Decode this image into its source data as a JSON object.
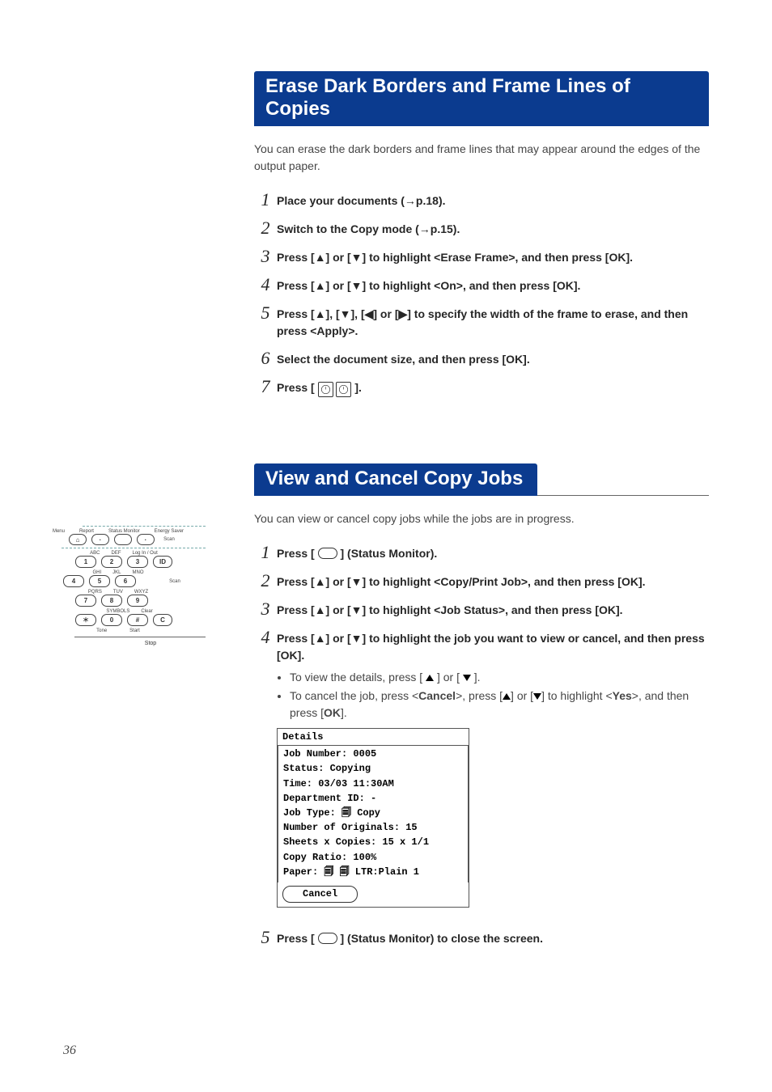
{
  "page_number": "36",
  "sectionA": {
    "title": "Erase Dark Borders and Frame Lines of Copies",
    "intro": "You can erase the dark borders and frame lines that may appear around the edges of the output paper.",
    "steps": [
      "Place your documents (→p.18).",
      "Switch to the Copy mode (→p.15).",
      "Press [▲] or [▼] to highlight <Erase Frame>, and then press [OK].",
      "Press [▲] or [▼] to highlight <On>, and then press [OK].",
      "Press [▲], [▼], [◀] or [▶] to specify the width of the frame to erase, and then press <Apply>.",
      "Select the document size, and then press [OK].",
      "__PRESS_START__"
    ],
    "step7_prefix": "Press [",
    "step7_suffix": "]."
  },
  "sectionB": {
    "title": "View and Cancel Copy Jobs",
    "intro": "You can view or cancel copy jobs while the jobs are in progress.",
    "steps": {
      "s1_prefix": "Press [",
      "s1_suffix": "] (Status Monitor).",
      "s2": "Press [▲] or [▼] to highlight <Copy/Print Job>, and then press [OK].",
      "s3": "Press [▲] or [▼] to highlight <Job Status>, and then press [OK].",
      "s4": "Press [▲] or [▼] to highlight the job you want to view or cancel, and then press [OK].",
      "s4_b1_prefix": "To view the details, press [",
      "s4_b1_mid": "] or [",
      "s4_b1_suffix": "].",
      "s4_b2_a": "To cancel the job, press <",
      "s4_b2_cancel": "Cancel",
      "s4_b2_b": ">, press [",
      "s4_b2_c": "] or [",
      "s4_b2_d": "] to highlight <",
      "s4_b2_yes": "Yes",
      "s4_b2_e": ">, and then press [",
      "s4_b2_ok": "OK",
      "s4_b2_f": "].",
      "s5_prefix": "Press [",
      "s5_suffix": "] (Status Monitor) to close the screen."
    }
  },
  "details": {
    "header": "Details",
    "rows": [
      "Job Number: 0005",
      "Status: Copying",
      "Time: 03/03 11:30AM",
      "Department ID: -",
      "Job Type: 🗐 Copy",
      "Number of Originals: 15",
      "Sheets x Copies: 15 x 1/1",
      "Copy Ratio: 100%",
      "Paper: 🗐 🗐 LTR:Plain 1"
    ],
    "cancel": "Cancel"
  },
  "keypad": {
    "top_labels": [
      "Menu",
      "Report",
      "Status Monitor",
      "Energy Saver"
    ],
    "row1_labels": [
      "",
      "ABC",
      "DEF",
      "Log In / Out"
    ],
    "row2_labels": [
      "GHI",
      "JKL",
      "MNO"
    ],
    "row3_labels": [
      "PQRS",
      "TUV",
      "WXYZ"
    ],
    "row4_labels": [
      "",
      "",
      "SYMBOLS",
      "Clear"
    ],
    "tone": "Tone",
    "start": "Start",
    "stop": "Stop",
    "scan": "Scan",
    "id": "ID"
  }
}
